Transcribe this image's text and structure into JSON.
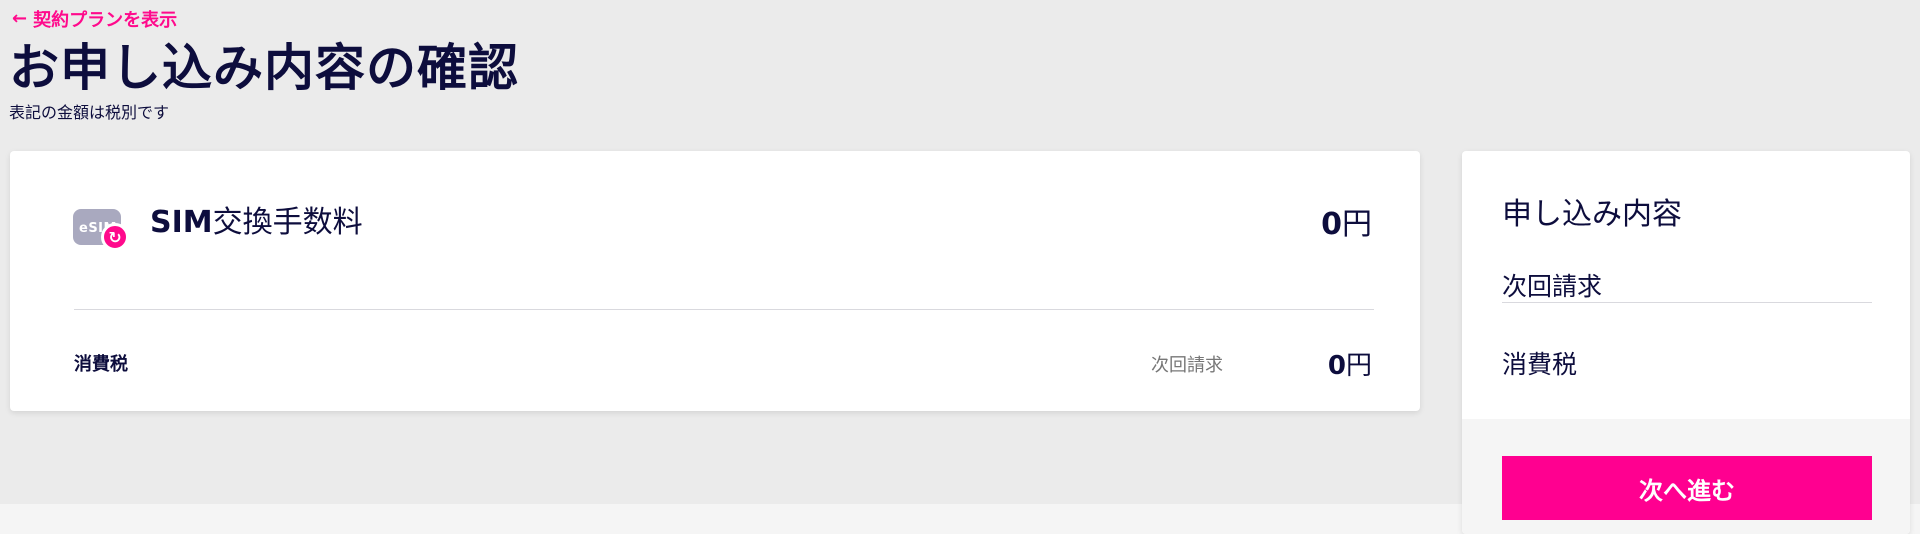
{
  "header": {
    "back_link": "契約プランを表示",
    "title": "お申し込み内容の確認",
    "tax_note": "表記の金額は税別です"
  },
  "fee_item": {
    "icon_text": "eSIM",
    "name_en": "SIM",
    "name_ja": "交換手数料",
    "price_value": "0",
    "price_unit": "円"
  },
  "tax_row": {
    "label": "消費税",
    "billing": "次回請求",
    "price_value": "0",
    "price_unit": "円"
  },
  "summary": {
    "title": "申し込み内容",
    "billing_label": "次回請求",
    "tax_label": "消費税",
    "next_button": "次へ進む"
  },
  "colors": {
    "accent": "#ff0090",
    "text": "#0d0d3d",
    "background": "#ebebeb"
  }
}
